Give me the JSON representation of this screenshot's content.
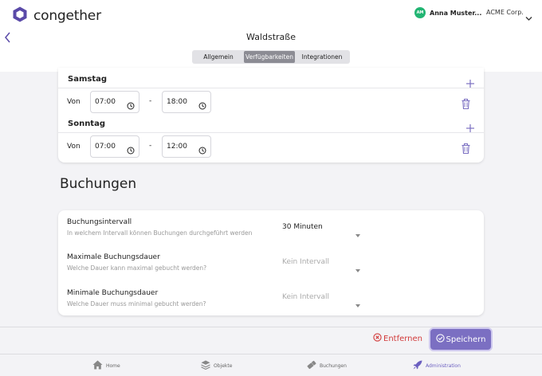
{
  "header": {
    "logo_text": "congether",
    "user_initials": "AM",
    "user_name": "Anna Muster...",
    "org_name": "ACME Corp.",
    "page_title": "Waldstraße",
    "tabs": [
      {
        "label": "Allgemein"
      },
      {
        "label": "Verfügbarkeiten",
        "active": true
      },
      {
        "label": "Integrationen"
      }
    ]
  },
  "availability": {
    "days": [
      {
        "name": "Samstag",
        "from_label": "Von",
        "start": "07:00",
        "separator": "-",
        "end": "18:00"
      },
      {
        "name": "Sonntag",
        "from_label": "Von",
        "start": "07:00",
        "separator": "-",
        "end": "12:00"
      }
    ]
  },
  "bookings": {
    "title": "Buchungen",
    "settings": [
      {
        "label": "Buchungsintervall",
        "description": "In welchem Intervall können Buchungen durchgeführt werden",
        "value": "30 Minuten"
      },
      {
        "label": "Maximale Buchungsdauer",
        "description": "Welche Dauer kann maximal gebucht werden?",
        "value": "Kein Intervall"
      },
      {
        "label": "Minimale Buchungsdauer",
        "description": "Welche Dauer muss minimal gebucht werden?",
        "value": "Kein Intervall"
      }
    ]
  },
  "actions": {
    "remove_label": "Entfernen",
    "save_label": "Speichern"
  },
  "nav": {
    "items": [
      {
        "label": "Home"
      },
      {
        "label": "Objekte"
      },
      {
        "label": "Buchungen"
      },
      {
        "label": "Administration",
        "active": true
      }
    ]
  },
  "colors": {
    "accent": "#7b6fc2",
    "danger": "#d23b3b",
    "avatar": "#22b573",
    "logo": "#5a4aa8"
  }
}
